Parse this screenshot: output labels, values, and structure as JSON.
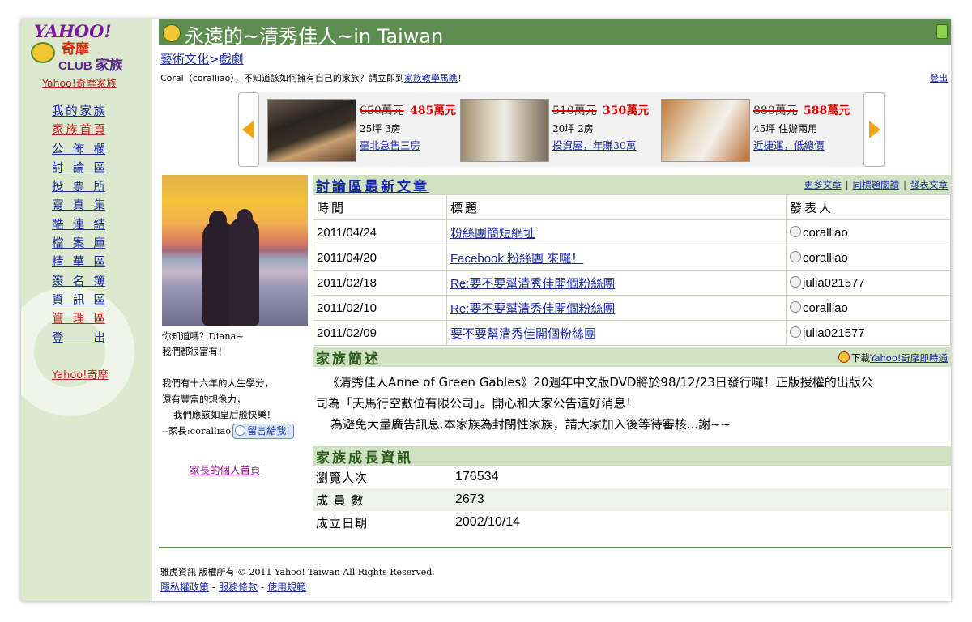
{
  "sidebar": {
    "logo_yahoo": "YAHOO!",
    "logo_qimo": "奇摩",
    "logo_club": "CLUB",
    "logo_family": "家族",
    "subtitle": "Yahoo!奇摩家族",
    "items": [
      {
        "label": "我的家族"
      },
      {
        "label": "家族首頁"
      },
      {
        "label": "公佈欄"
      },
      {
        "label": "討論區"
      },
      {
        "label": "投票所"
      },
      {
        "label": "寫真集"
      },
      {
        "label": "酷連結"
      },
      {
        "label": "檔案庫"
      },
      {
        "label": "精華區"
      },
      {
        "label": "簽名簿"
      },
      {
        "label": "資訊區"
      },
      {
        "label": "管理區"
      },
      {
        "label": "登出"
      }
    ],
    "bottom": "Yahoo!奇摩"
  },
  "header": {
    "title": "永遠的~清秀佳人~in Taiwan",
    "crumb_category": "藝術文化",
    "crumb_sep": ">",
    "crumb_sub": "戲劇",
    "notice_prefix": "Coral（coralliao），不知道該如何擁有自己的家族？請立即到",
    "notice_link": "家族教學馬瞧",
    "notice_suffix": "！",
    "logout": "登出"
  },
  "ads": [
    {
      "old_price": "650萬元",
      "new_price": "485萬元",
      "spec": "25坪 3房",
      "link": "臺北急售三房"
    },
    {
      "old_price": "510萬元",
      "new_price": "350萬元",
      "spec": "20坪 2房",
      "link": "投資屋，年賺30萬"
    },
    {
      "old_price": "880萬元",
      "new_price": "588萬元",
      "spec": "45坪 住辦兩用",
      "link": "近捷運，低總價"
    }
  ],
  "profile": {
    "line1": "你知道嗎？Diana~",
    "line2": "我們都很富有！",
    "line3": "我們有十六年的人生學分，",
    "line4": "還有豐富的想像力，",
    "line5": "我們應該如皇后般快樂！",
    "owner": "--家長:coralliao",
    "msg_button": "留言給我!",
    "owner_home": "家長的個人首頁"
  },
  "discussion": {
    "title": "討論區最新文章",
    "more": "更多文章",
    "same_topic": "同標題閱讀",
    "post": "發表文章",
    "bar": "|",
    "columns": [
      "時間",
      "標題",
      "發表人"
    ],
    "rows": [
      {
        "date": "2011/04/24",
        "title": "粉絲團簡短網址",
        "author": "coralliao"
      },
      {
        "date": "2011/04/20",
        "title": "Facebook 粉絲團 來囉！",
        "author": "coralliao"
      },
      {
        "date": "2011/02/18",
        "title": "Re:要不要幫清秀佳開個粉絲團",
        "author": "julia021577"
      },
      {
        "date": "2011/02/10",
        "title": "Re:要不要幫清秀佳開個粉絲團",
        "author": "coralliao"
      },
      {
        "date": "2011/02/09",
        "title": "要不要幫清秀佳開個粉絲團",
        "author": "julia021577"
      }
    ]
  },
  "description": {
    "title": "家族簡述",
    "download_prefix": "下載",
    "download_link": "Yahoo!奇摩即時通",
    "line1": "《清秀佳人Anne of Green Gables》20週年中文版DVD將於98/12/23日發行囉！正版授權的出版公",
    "line2": "司為「天馬行空數位有限公司」。開心和大家公告這好消息！",
    "line3": "為避免大量廣告訊息.本家族為封閉性家族，請大家加入後等待審核...謝~~"
  },
  "growth": {
    "title": "家族成長資訊",
    "rows": [
      {
        "label": "瀏覽人次",
        "value": "176534"
      },
      {
        "label": "成 員 數",
        "value": "2673"
      },
      {
        "label": "成立日期",
        "value": "2002/10/14"
      }
    ]
  },
  "footer": {
    "copyright": "雅虎資訊 版權所有 © 2011 Yahoo! Taiwan All Rights Reserved.",
    "privacy": "隱私權政策",
    "dash": "-",
    "terms": "服務條款",
    "usage": "使用規範"
  },
  "colors": {
    "title_bar": "#5d8e4f",
    "section_bg": "#cfe2c1",
    "sidebar_bg": "#dde9cf",
    "link": "#1a2aa0",
    "accent_red": "#c02020"
  }
}
